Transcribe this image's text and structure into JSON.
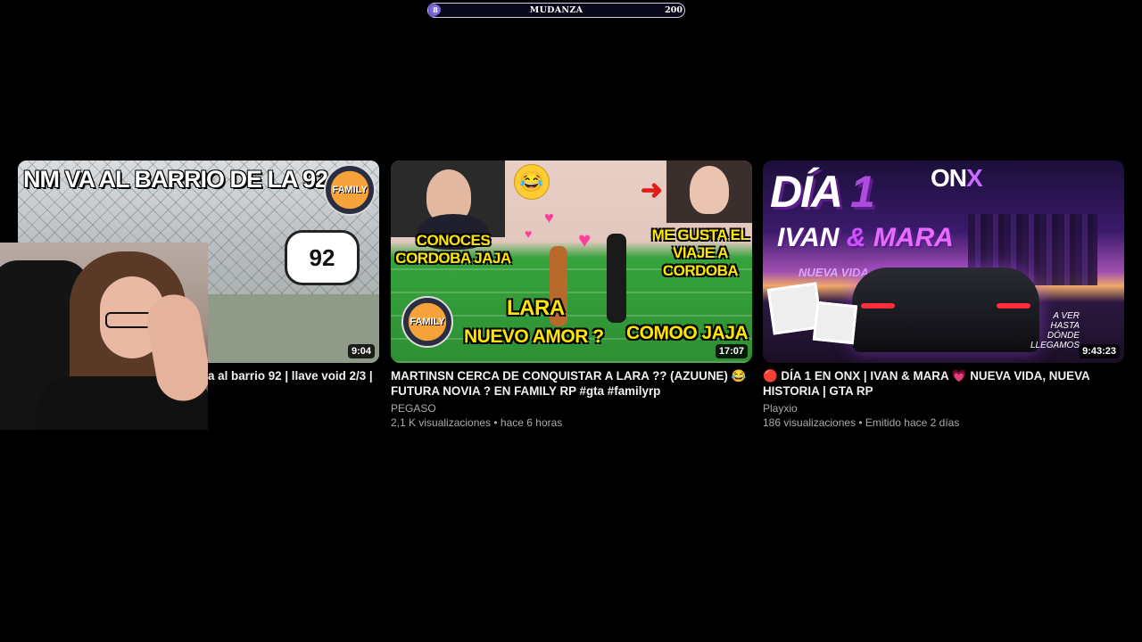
{
  "goal_bar": {
    "start_label": "8",
    "title": "MUDANZA",
    "target": "200",
    "progress_fraction": 0.04
  },
  "videos": [
    {
      "thumb_headline": "NM VA AL BARRIO DE LA 92",
      "thumb_badge": "FAMILY",
      "thumb_graffiti": "92",
      "duration": "9:04",
      "title": "a al barrio 92 | llave void 2/3 |",
      "channel": "",
      "meta": ""
    },
    {
      "thumb_caption_1": "CONOCES CORDOBA JAJA",
      "thumb_caption_2": "ME GUSTA EL VIAJE A CORDOBA",
      "thumb_caption_3": "LARA",
      "thumb_caption_4": "NUEVO AMOR ?",
      "thumb_caption_5": "COMOO JAJA",
      "thumb_badge": "FAMILY",
      "duration": "17:07",
      "title": "MARTINSN CERCA DE CONQUISTAR A LARA ?? (AZUUNE) 😂 FUTURA NOVIA ? EN FAMILY RP #gta #familyrp",
      "channel": "PEGASO",
      "meta": "2,1 K visualizaciones • hace 6 horas"
    },
    {
      "thumb_title": "DÍA",
      "thumb_number": "1",
      "thumb_name_1": "IVAN",
      "thumb_amp": "&",
      "thumb_name_2": "MARA",
      "thumb_sub": "NUEVA VIDA",
      "thumb_logo": "ON",
      "thumb_logo_x": "X",
      "thumb_corner": "A VER HASTA DÓNDE LLEGAMOS",
      "duration": "9:43:23",
      "title": "🔴 DÍA 1 EN ONX | IVAN & MARA 💗 NUEVA VIDA, NUEVA HISTORIA | GTA RP",
      "channel": "Playxio",
      "meta": "186 visualizaciones • Emitido hace 2 días"
    }
  ],
  "colors": {
    "background": "#000000",
    "meta_text": "#aaaaaa",
    "goal_accent": "#6a5acd"
  }
}
